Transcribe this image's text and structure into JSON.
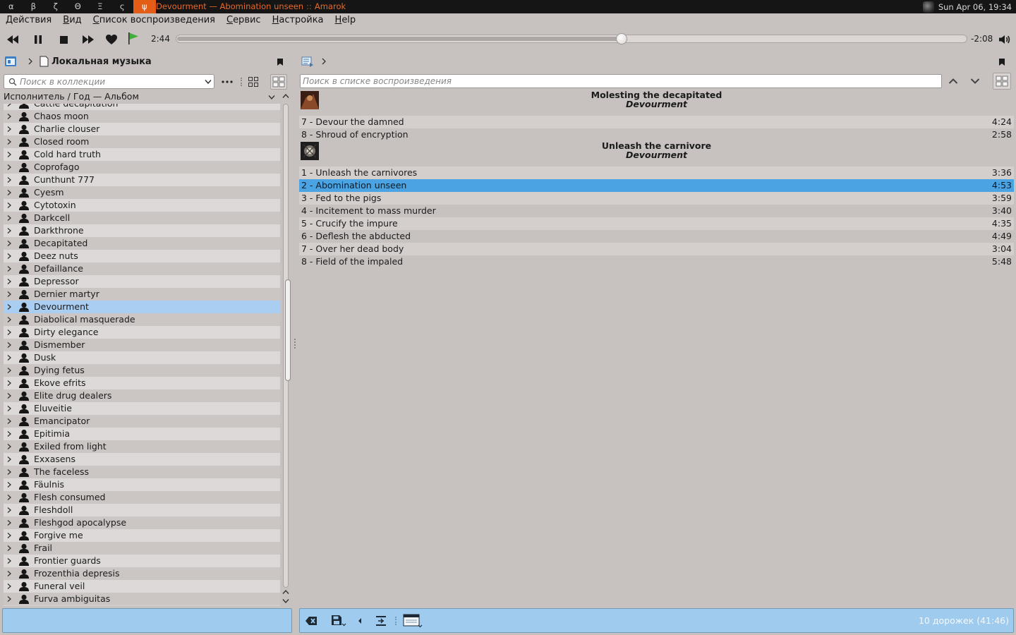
{
  "topbar": {
    "workspaces": [
      "α",
      "β",
      "ζ",
      "Θ",
      "Ξ",
      "ς",
      "ψ"
    ],
    "active_workspace": 6,
    "window_title_track": "Devourment — Abomination unseen",
    "window_title_sep": "::",
    "window_title_app": "Amarok",
    "clock": "Sun Apr 06, 19:34"
  },
  "menu": {
    "items": [
      {
        "u": "Д",
        "rest": "ействия"
      },
      {
        "u": "В",
        "rest": "ид"
      },
      {
        "u": "С",
        "rest": "писок воспроизведения"
      },
      {
        "u": "С",
        "rest": "ервис"
      },
      {
        "u": "Н",
        "rest": "астройка"
      },
      {
        "u": "H",
        "rest": "elp"
      }
    ]
  },
  "transport": {
    "elapsed": "2:44",
    "remaining": "-2:08",
    "progress": 0.563
  },
  "collection": {
    "title": "Локальная музыка",
    "search_placeholder": "Поиск в коллекции",
    "sort_label": "Исполнитель / Год — Альбом",
    "selected": "Devourment",
    "artists": [
      "Cattle decapitation",
      "Chaos moon",
      "Charlie clouser",
      "Closed room",
      "Cold hard truth",
      "Coprofago",
      "Cunthunt 777",
      "Cyesm",
      "Cytotoxin",
      "Darkcell",
      "Darkthrone",
      "Decapitated",
      "Deez nuts",
      "Defaillance",
      "Depressor",
      "Dernier martyr",
      "Devourment",
      "Diabolical masquerade",
      "Dirty elegance",
      "Dismember",
      "Dusk",
      "Dying fetus",
      "Ekove efrits",
      "Elite drug dealers",
      "Eluveitie",
      "Emancipator",
      "Epitimia",
      "Exiled from light",
      "Exxasens",
      "The faceless",
      "Fäulnis",
      "Flesh consumed",
      "Fleshdoll",
      "Fleshgod apocalypse",
      "Forgive me",
      "Frail",
      "Frontier guards",
      "Frozenthia depresis",
      "Funeral veil",
      "Furva ambiguitas"
    ]
  },
  "playlist": {
    "search_placeholder": "Поиск в списке воспроизведения",
    "count_label": "10 дорожек (41:46)",
    "groups": [
      {
        "title": "Molesting the decapitated",
        "artist": "Devourment",
        "tracks": [
          {
            "name": "7 - Devour the damned",
            "length": "4:24",
            "playing": false
          },
          {
            "name": "8 - Shroud of encryption",
            "length": "2:58",
            "playing": false
          }
        ]
      },
      {
        "title": "Unleash the carnivore",
        "artist": "Devourment",
        "tracks": [
          {
            "name": "1 - Unleash the carnivores",
            "length": "3:36",
            "playing": false
          },
          {
            "name": "2 - Abomination unseen",
            "length": "4:53",
            "playing": true
          },
          {
            "name": "3 - Fed to the pigs",
            "length": "3:59",
            "playing": false
          },
          {
            "name": "4 - Incitement to mass murder",
            "length": "3:40",
            "playing": false
          },
          {
            "name": "5 - Crucify the impure",
            "length": "4:35",
            "playing": false
          },
          {
            "name": "6 - Deflesh the abducted",
            "length": "4:49",
            "playing": false
          },
          {
            "name": "7 - Over her dead body",
            "length": "3:04",
            "playing": false
          },
          {
            "name": "8 - Field of the impaled",
            "length": "5:48",
            "playing": false
          }
        ]
      }
    ]
  },
  "colors": {
    "background": "#c7c1bf",
    "selection": "#4aa3e2",
    "tree_selection": "#a9cef2",
    "panel_blue": "#9ecbee",
    "accent_orange": "#e35d16"
  },
  "icons": {
    "transport": [
      "previous-icon",
      "pause-icon",
      "stop-icon",
      "next-icon",
      "love-heart-icon",
      "bookmark-flag-icon",
      "volume-icon"
    ],
    "collection_header": [
      "collection-icon",
      "breadcrumb-arrow-icon",
      "document-icon",
      "bookmark-icon"
    ],
    "playlist_toolbar": [
      "clear-playlist-icon",
      "save-playlist-icon",
      "back-icon",
      "playlist-layout-icon",
      "playlist-view-icon"
    ]
  }
}
